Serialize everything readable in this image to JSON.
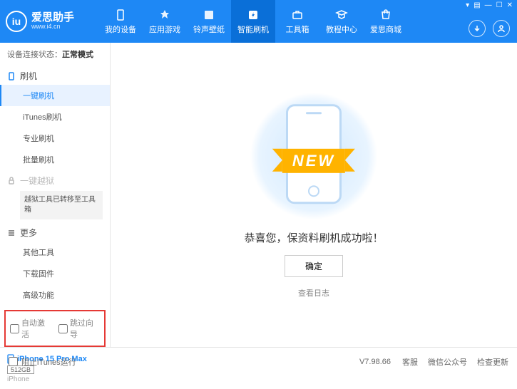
{
  "header": {
    "app_name": "爱思助手",
    "app_url": "www.i4.cn",
    "nav": [
      {
        "label": "我的设备"
      },
      {
        "label": "应用游戏"
      },
      {
        "label": "铃声壁纸"
      },
      {
        "label": "智能刷机"
      },
      {
        "label": "工具箱"
      },
      {
        "label": "教程中心"
      },
      {
        "label": "爱思商城"
      }
    ]
  },
  "sidebar": {
    "status_label": "设备连接状态：",
    "status_value": "正常模式",
    "sec_flash": "刷机",
    "items_flash": [
      "一键刷机",
      "iTunes刷机",
      "专业刷机",
      "批量刷机"
    ],
    "sec_jail": "一键越狱",
    "jail_note": "越狱工具已转移至工具箱",
    "sec_more": "更多",
    "items_more": [
      "其他工具",
      "下载固件",
      "高级功能"
    ],
    "opt_auto": "自动激活",
    "opt_skip": "跳过向导",
    "device": {
      "name": "iPhone 15 Pro Max",
      "capacity": "512GB",
      "type": "iPhone"
    }
  },
  "main": {
    "ribbon": "NEW",
    "success": "恭喜您，保资料刷机成功啦！",
    "ok": "确定",
    "log": "查看日志"
  },
  "footer": {
    "block_itunes": "阻止iTunes运行",
    "version": "V7.98.66",
    "links": [
      "客服",
      "微信公众号",
      "检查更新"
    ]
  }
}
